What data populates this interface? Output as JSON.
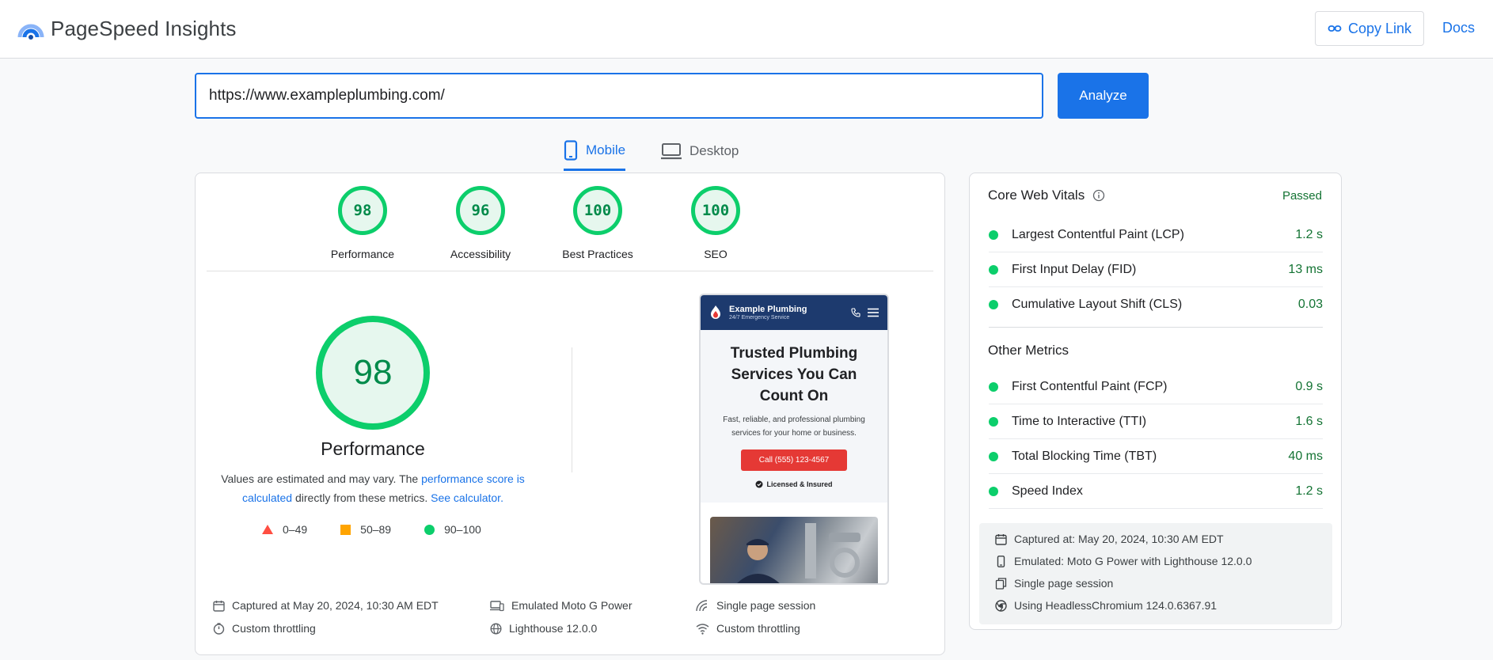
{
  "header": {
    "brand": "PageSpeed Insights",
    "copy_link_label": "Copy Link",
    "docs_label": "Docs"
  },
  "search": {
    "url_value": "https://www.exampleplumbing.com/",
    "analyze_label": "Analyze"
  },
  "tabs": [
    {
      "label": "Mobile",
      "active": true
    },
    {
      "label": "Desktop",
      "active": false
    }
  ],
  "scores": [
    {
      "label": "Performance",
      "value": "98"
    },
    {
      "label": "Accessibility",
      "value": "96"
    },
    {
      "label": "Best Practices",
      "value": "100"
    },
    {
      "label": "SEO",
      "value": "100"
    }
  ],
  "performance": {
    "score": "98",
    "title": "Performance",
    "note_pre": "Values are estimated and may vary. The ",
    "note_link1": "performance score is calculated",
    "note_mid": " directly from these metrics. ",
    "note_link2": "See calculator."
  },
  "legend": [
    {
      "range": "0–49",
      "color": "#ff4e42"
    },
    {
      "range": "50–89",
      "color": "#ffa400"
    },
    {
      "range": "90–100",
      "color": "#0cce6b"
    }
  ],
  "preview": {
    "site_name": "Example Plumbing",
    "site_tagline": "24/7 Emergency Service",
    "hero_title": "Trusted Plumbing Services You Can Count On",
    "hero_desc": "Fast, reliable, and professional plumbing services for your home or business.",
    "call_label": "Call (555) 123-4567",
    "licensed_label": "Licensed & Insured"
  },
  "run_info": {
    "captured": "Captured at May 20, 2024, 10:30 AM EDT",
    "emulated": "Emulated Moto G Power",
    "session": "Single page session",
    "throttling_1": "Custom throttling",
    "lighthouse": "Lighthouse 12.0.0",
    "throttling_2": "Custom throttling"
  },
  "core_web_vitals": {
    "title": "Core Web Vitals",
    "status": "Passed",
    "metrics": [
      {
        "name": "Largest Contentful Paint (LCP)",
        "value": "1.2 s"
      },
      {
        "name": "First Input Delay (FID)",
        "value": "13 ms"
      },
      {
        "name": "Cumulative Layout Shift (CLS)",
        "value": "0.03"
      }
    ]
  },
  "other_metrics": {
    "title": "Other Metrics",
    "metrics": [
      {
        "name": "First Contentful Paint (FCP)",
        "value": "0.9 s"
      },
      {
        "name": "Time to Interactive (TTI)",
        "value": "1.6 s"
      },
      {
        "name": "Total Blocking Time (TBT)",
        "value": "40 ms"
      },
      {
        "name": "Speed Index",
        "value": "1.2 s"
      }
    ]
  },
  "environment": {
    "captured": "Captured at: May 20, 2024, 10:30 AM EDT",
    "emulated": "Emulated: Moto G Power with Lighthouse 12.0.0",
    "session": "Single page session",
    "browser": "Using HeadlessChromium 124.0.6367.91"
  },
  "colors": {
    "accent": "#1a73e8",
    "good": "#0cce6b",
    "good_text": "#137333"
  }
}
